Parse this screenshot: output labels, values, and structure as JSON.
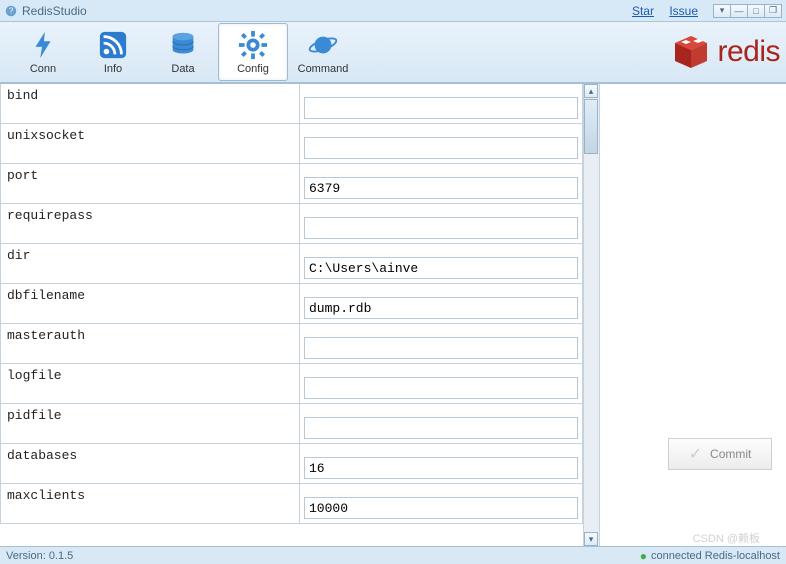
{
  "app": {
    "title": "RedisStudio",
    "links": {
      "star": "Star",
      "issue": "Issue"
    }
  },
  "toolbar": {
    "items": [
      {
        "id": "conn",
        "label": "Conn"
      },
      {
        "id": "info",
        "label": "Info"
      },
      {
        "id": "data",
        "label": "Data"
      },
      {
        "id": "config",
        "label": "Config"
      },
      {
        "id": "command",
        "label": "Command"
      }
    ],
    "active": "config",
    "brand": "redis"
  },
  "config": {
    "rows": [
      {
        "key": "bind",
        "value": ""
      },
      {
        "key": "unixsocket",
        "value": ""
      },
      {
        "key": "port",
        "value": "6379"
      },
      {
        "key": "requirepass",
        "value": ""
      },
      {
        "key": "dir",
        "value": "C:\\Users\\ainve"
      },
      {
        "key": "dbfilename",
        "value": "dump.rdb"
      },
      {
        "key": "masterauth",
        "value": ""
      },
      {
        "key": "logfile",
        "value": ""
      },
      {
        "key": "pidfile",
        "value": ""
      },
      {
        "key": "databases",
        "value": "16"
      },
      {
        "key": "maxclients",
        "value": "10000"
      }
    ]
  },
  "actions": {
    "commit": "Commit"
  },
  "status": {
    "version_label": "Version:",
    "version": "0.1.5",
    "conn": "connected Redis-localhost"
  },
  "watermark": "CSDN @赖板"
}
